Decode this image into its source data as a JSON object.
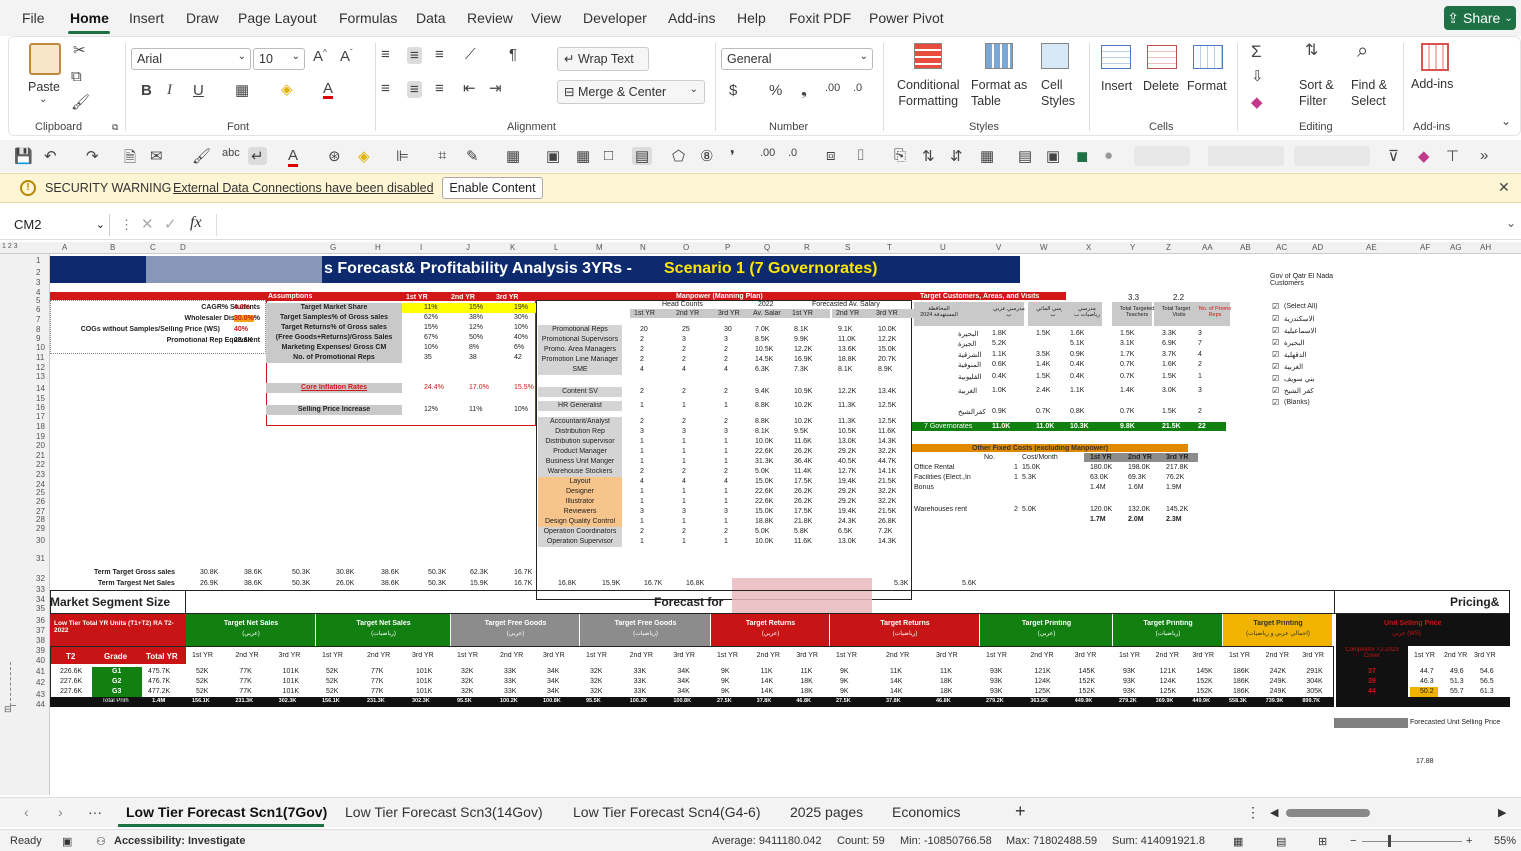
{
  "menu": {
    "items": [
      "File",
      "Home",
      "Insert",
      "Draw",
      "Page Layout",
      "Formulas",
      "Data",
      "Review",
      "View",
      "Developer",
      "Add-ins",
      "Help",
      "Foxit PDF",
      "Power Pivot"
    ],
    "share": "Share"
  },
  "ribbon": {
    "clipboard": {
      "paste": "Paste",
      "label": "Clipboard"
    },
    "font": {
      "name": "Arial",
      "size": "10",
      "label": "Font"
    },
    "alignment": {
      "wrap": "Wrap Text",
      "merge": "Merge & Center",
      "label": "Alignment"
    },
    "number": {
      "format": "General",
      "label": "Number"
    },
    "styles": {
      "conditional": "Conditional\nFormatting",
      "format_table": "Format as\nTable",
      "cell_styles": "Cell\nStyles",
      "label": "Styles"
    },
    "cells": {
      "insert": "Insert",
      "delete": "Delete",
      "format": "Format",
      "label": "Cells"
    },
    "editing": {
      "sort": "Sort &\nFilter",
      "find": "Find &\nSelect",
      "label": "Editing"
    },
    "addins": {
      "addins": "Add-ins",
      "label": "Add-ins"
    }
  },
  "security": {
    "title": "SECURITY WARNING",
    "message": "External Data Connections have been disabled",
    "button": "Enable Content"
  },
  "formula": {
    "name_box": "CM2",
    "fx": "fx",
    "value": ""
  },
  "columns": [
    "A",
    "B",
    "C",
    "D",
    "G",
    "H",
    "I",
    "J",
    "K",
    "L",
    "M",
    "N",
    "O",
    "P",
    "Q",
    "R",
    "S",
    "T",
    "U",
    "V",
    "W",
    "X",
    "Y",
    "Z",
    "AA",
    "AB",
    "AC",
    "AD",
    "AE",
    "AF",
    "AG",
    "AH"
  ],
  "rows": [
    "1",
    "2",
    "3",
    "4",
    "5",
    "6",
    "7",
    "8",
    "9",
    "10",
    "11",
    "12",
    "13",
    "14",
    "15",
    "16",
    "17",
    "18",
    "19",
    "20",
    "21",
    "22",
    "23",
    "24",
    "25",
    "26",
    "27",
    "28",
    "29",
    "30",
    "31",
    "32",
    "33",
    "34",
    "35",
    "36",
    "37",
    "38",
    "39",
    "40",
    "41",
    "42",
    "43",
    "44"
  ],
  "sheet": {
    "title_left": "s Forecast& Profitability Analysis 3YRs - ",
    "title_right": "Scenario 1 (7 Governorates)",
    "assumptions": {
      "header": "Assumptions",
      "rows": [
        {
          "label": "CAGR% Students",
          "val": "4.0%"
        },
        {
          "label": "Wholesaler Discount%",
          "val": "30.0%"
        },
        {
          "label": "COGs without Samples/Selling Price (WS)",
          "val": "40%"
        },
        {
          "label": "Promotional Rep Equivalent",
          "val": "28.6K"
        }
      ],
      "yr_heads": [
        "1st YR",
        "2nd YR",
        "3rd YR"
      ],
      "metrics": [
        {
          "label": "Target Market Share",
          "v": [
            "11%",
            "15%",
            "19%"
          ]
        },
        {
          "label": "Target Samples% of Gross sales",
          "v": [
            "62%",
            "38%",
            "30%"
          ]
        },
        {
          "label": "Target Returns% of Gross sales",
          "v": [
            "15%",
            "12%",
            "10%"
          ]
        },
        {
          "label": "(Free Goods+Returns)/Gross Sales",
          "v": [
            "67%",
            "50%",
            "40%"
          ]
        },
        {
          "label": "Marketing Expenses/ Gross CM",
          "v": [
            "10%",
            "8%",
            "6%"
          ]
        },
        {
          "label": "No. of Promotional Reps",
          "v": [
            "35",
            "38",
            "42"
          ]
        },
        {
          "label": "Core Inflation Rates",
          "v": [
            "24.4%",
            "17.0%",
            "15.5%"
          ]
        },
        {
          "label": "Selling Price Increase",
          "v": [
            "12%",
            "11%",
            "10%"
          ]
        }
      ]
    },
    "manpower": {
      "header": "Manpower (Manning Plan)",
      "sub1": "Head Counts",
      "sub2": "2022",
      "sub3": "Forecasted Av. Salary",
      "cols": [
        "1st YR",
        "2nd YR",
        "3rd YR",
        "Av. Salar",
        "1st YR",
        "2nd YR",
        "3rd YR"
      ],
      "rows": [
        {
          "label": "Promotional Reps",
          "v": [
            "20",
            "25",
            "30",
            "7.0K",
            "8.1K",
            "9.1K",
            "10.0K"
          ]
        },
        {
          "label": "Promotional Supervisors",
          "v": [
            "2",
            "3",
            "3",
            "8.5K",
            "9.9K",
            "11.0K",
            "12.2K"
          ]
        },
        {
          "label": "Promo. Area Managers",
          "v": [
            "2",
            "2",
            "2",
            "10.5K",
            "12.2K",
            "13.6K",
            "15.0K"
          ]
        },
        {
          "label": "Promotion Line Manager",
          "v": [
            "2",
            "2",
            "2",
            "14.5K",
            "16.9K",
            "18.8K",
            "20.7K"
          ]
        },
        {
          "label": "SME",
          "v": [
            "4",
            "4",
            "4",
            "6.3K",
            "7.3K",
            "8.1K",
            "8.9K"
          ]
        },
        {
          "label": "Content SV",
          "v": [
            "2",
            "2",
            "2",
            "9.4K",
            "10.9K",
            "12.2K",
            "13.4K"
          ]
        },
        {
          "label": "HR Generalist",
          "v": [
            "1",
            "1",
            "1",
            "8.8K",
            "10.2K",
            "11.3K",
            "12.5K"
          ]
        },
        {
          "label": "Accountant/Analyst",
          "v": [
            "2",
            "2",
            "2",
            "8.8K",
            "10.2K",
            "11.3K",
            "12.5K"
          ]
        },
        {
          "label": "Distribution Rep",
          "v": [
            "3",
            "3",
            "3",
            "8.1K",
            "9.5K",
            "10.5K",
            "11.6K"
          ]
        },
        {
          "label": "Distribution supervisor",
          "v": [
            "1",
            "1",
            "1",
            "10.0K",
            "11.6K",
            "13.0K",
            "14.3K"
          ]
        },
        {
          "label": "Product Manager",
          "v": [
            "1",
            "1",
            "1",
            "22.6K",
            "26.2K",
            "29.2K",
            "32.2K"
          ]
        },
        {
          "label": "Business Unit Manger",
          "v": [
            "1",
            "1",
            "1",
            "31.3K",
            "36.4K",
            "40.5K",
            "44.7K"
          ]
        },
        {
          "label": "Warehouse Stockers",
          "v": [
            "2",
            "2",
            "2",
            "5.0K",
            "11.4K",
            "12.7K",
            "14.1K"
          ]
        },
        {
          "label": "Layout",
          "v": [
            "4",
            "4",
            "4",
            "15.0K",
            "17.5K",
            "19.4K",
            "21.5K"
          ]
        },
        {
          "label": "Designer",
          "v": [
            "1",
            "1",
            "1",
            "22.6K",
            "26.2K",
            "29.2K",
            "32.2K"
          ]
        },
        {
          "label": "Illustrator",
          "v": [
            "1",
            "1",
            "1",
            "22.6K",
            "26.2K",
            "29.2K",
            "32.2K"
          ]
        },
        {
          "label": "Reviewers",
          "v": [
            "3",
            "3",
            "3",
            "15.0K",
            "17.5K",
            "19.4K",
            "21.5K"
          ]
        },
        {
          "label": "Design Quality Control",
          "v": [
            "1",
            "1",
            "1",
            "18.8K",
            "21.8K",
            "24.3K",
            "26.8K"
          ]
        },
        {
          "label": "Operation Coordinators",
          "v": [
            "2",
            "2",
            "2",
            "5.0K",
            "5.8K",
            "6.5K",
            "7.2K"
          ]
        },
        {
          "label": "Operation Supervisor",
          "v": [
            "1",
            "1",
            "1",
            "10.0K",
            "11.6K",
            "13.0K",
            "14.3K"
          ]
        }
      ]
    },
    "customers": {
      "header": "Target Customers, Areas, and Visits",
      "v33": "3.3",
      "v22": "2.2",
      "cols": [
        "المحافظة المستهدفة 2024",
        "مدرسي عربي ب",
        "مدرسي الماتي ب",
        "مدرسي رياضيات ب",
        "Total Targeted Teachers",
        "Total Targeted Visits",
        "No. of Promo Reps"
      ],
      "rows": [
        {
          "g": "البحيرة",
          "v": [
            "1.8K",
            "1.5K",
            "1.6K",
            "1.5K",
            "3.3K",
            "3"
          ]
        },
        {
          "g": "الجيزة",
          "v": [
            "5.2K",
            "",
            "5.1K",
            "3.1K",
            "6.9K",
            "7"
          ]
        },
        {
          "g": "الشرقية",
          "v": [
            "1.1K",
            "3.5K",
            "0.9K",
            "1.7K",
            "3.7K",
            "4"
          ]
        },
        {
          "g": "المنوفية",
          "v": [
            "0.6K",
            "1.4K",
            "0.4K",
            "0.7K",
            "1.6K",
            "2"
          ]
        },
        {
          "g": "القليوبية",
          "v": [
            "0.4K",
            "1.5K",
            "0.4K",
            "0.7K",
            "1.5K",
            "1"
          ]
        },
        {
          "g": "الغربية",
          "v": [
            "1.0K",
            "2.4K",
            "1.1K",
            "1.4K",
            "3.0K",
            "3"
          ]
        },
        {
          "g": "كفرالشيخ",
          "v": [
            "0.9K",
            "0.7K",
            "0.8K",
            "0.7K",
            "1.5K",
            "2"
          ]
        }
      ],
      "total": {
        "label": "7 Governorates",
        "v": [
          "11.0K",
          "11.0K",
          "10.3K",
          "9.8K",
          "21.5K",
          "22"
        ]
      }
    },
    "filter": {
      "title": "Gov of Qatr El Nada Customers",
      "items": [
        "(Select All)",
        "الاسكندرية",
        "الاسماعيلية",
        "البحيرة",
        "الدقهلية",
        "الغربية",
        "بني سويف",
        "كفر الشيخ",
        "(Blanks)"
      ]
    },
    "fixed_costs": {
      "header": "Other Fixed Costs (excluding Manpower)",
      "cols": [
        "No.",
        "Cost/Month",
        "1st YR",
        "2nd YR",
        "3rd YR"
      ],
      "rows": [
        {
          "label": "Office Rental",
          "v": [
            "1",
            "15.0K",
            "180.0K",
            "198.0K",
            "217.8K"
          ]
        },
        {
          "label": "Facilities (Elect.,In",
          "v": [
            "1",
            "5.3K",
            "63.0K",
            "69.3K",
            "76.2K"
          ]
        },
        {
          "label": "Bonus",
          "v": [
            "",
            "",
            "1.4M",
            "1.6M",
            "1.9M"
          ]
        },
        {
          "label": "Warehouses rent",
          "v": [
            "2",
            "5.0K",
            "120.0K",
            "132.0K",
            "145.2K"
          ]
        },
        {
          "label": "",
          "v": [
            "",
            "",
            "1.7M",
            "2.0M",
            "2.3M"
          ]
        }
      ]
    },
    "targets": {
      "gross_label": "Term Target Gross sales",
      "net_label": "Term Targest Net Sales",
      "gross": [
        "30.8K",
        "38.6K",
        "50.3K",
        "30.8K",
        "38.6K",
        "50.3K",
        "62.3K",
        "16.7K"
      ],
      "net": [
        "26.9K",
        "38.6K",
        "50.3K",
        "26.0K",
        "38.6K",
        "50.3K",
        "15.9K",
        "16.7K",
        "16.8K",
        "15.9K",
        "16.7K",
        "16.8K",
        "5.3K",
        "5.6K"
      ]
    },
    "market": {
      "left": "Market Segment Size",
      "center": "Forecast for",
      "right": "Pricing&"
    },
    "lower": {
      "low_tier": "Low Tier Total YR Units (T1+T2) RA T2-2022",
      "t2": "T2",
      "grade": "Grade",
      "total_yr": "Total YR",
      "groups": [
        {
          "name": "Target Net Sales",
          "sub": "(عربي)",
          "color": "#118011"
        },
        {
          "name": "Target Net Sales",
          "sub": "(رياضيات)",
          "color": "#118011"
        },
        {
          "name": "Target Free Goods",
          "sub": "(عربي)",
          "color": "#8c8c8c"
        },
        {
          "name": "Target Free Goods",
          "sub": "(رياضيات)",
          "color": "#8c8c8c"
        },
        {
          "name": "Target Returns",
          "sub": "(عربي)",
          "color": "#c81414"
        },
        {
          "name": "Target Returns",
          "sub": "(رياضيات)",
          "color": "#c81414"
        },
        {
          "name": "Target Printing",
          "sub": "(عربي)",
          "color": "#118011"
        },
        {
          "name": "Target Printing",
          "sub": "(رياضيات)",
          "color": "#118011"
        },
        {
          "name": "Target Printing",
          "sub": "(اجمالي عربي و رياضيات)",
          "color": "#f0b400"
        }
      ],
      "yrs": [
        "1st YR",
        "2nd YR",
        "3rd YR"
      ],
      "rows": [
        {
          "t2": "226.6K",
          "g": "G1",
          "tot": "475.7K",
          "v": [
            "52K",
            "77K",
            "101K",
            "52K",
            "77K",
            "101K",
            "32K",
            "33K",
            "34K",
            "32K",
            "33K",
            "34K",
            "9K",
            "11K",
            "11K",
            "9K",
            "11K",
            "11K",
            "93K",
            "121K",
            "145K",
            "93K",
            "121K",
            "145K",
            "186K",
            "242K",
            "291K"
          ]
        },
        {
          "t2": "227.6K",
          "g": "G2",
          "tot": "476.7K",
          "v": [
            "52K",
            "77K",
            "101K",
            "52K",
            "77K",
            "101K",
            "32K",
            "33K",
            "34K",
            "32K",
            "33K",
            "34K",
            "9K",
            "14K",
            "18K",
            "9K",
            "14K",
            "18K",
            "93K",
            "124K",
            "152K",
            "93K",
            "124K",
            "152K",
            "186K",
            "249K",
            "304K"
          ]
        },
        {
          "t2": "227.6K",
          "g": "G3",
          "tot": "477.2K",
          "v": [
            "52K",
            "77K",
            "101K",
            "52K",
            "77K",
            "101K",
            "32K",
            "33K",
            "34K",
            "32K",
            "33K",
            "34K",
            "9K",
            "14K",
            "18K",
            "9K",
            "14K",
            "18K",
            "93K",
            "125K",
            "152K",
            "93K",
            "125K",
            "152K",
            "186K",
            "249K",
            "305K"
          ]
        }
      ],
      "total": {
        "label": "Total Prim",
        "tot": "1.4M",
        "v": [
          "156.1K",
          "231.3K",
          "302.3K",
          "156.1K",
          "231.3K",
          "302.3K",
          "95.5K",
          "100.2K",
          "100.8K",
          "95.5K",
          "100.2K",
          "100.8K",
          "27.5K",
          "37.8K",
          "46.8K",
          "27.5K",
          "37.8K",
          "46.8K",
          "279.2K",
          "363.5K",
          "449.9K",
          "279.2K",
          "369.9K",
          "449.9K",
          "558.3K",
          "739.9K",
          "899.7K"
        ]
      }
    },
    "pricing": {
      "header": "Unit Selling Price",
      "sub": "عربي (WS)",
      "competitor": "Competitor T2-2023 Cover",
      "yrs": [
        "1st YR",
        "2nd YR",
        "3rd YR"
      ],
      "rows": [
        {
          "c": "37",
          "v": [
            "44.7",
            "49.6",
            "54.6"
          ]
        },
        {
          "c": "39",
          "v": [
            "46.3",
            "51.3",
            "56.5"
          ]
        },
        {
          "c": "44",
          "v": [
            "50.2",
            "55.7",
            "61.3"
          ]
        }
      ],
      "legend": "Forecasted Unit Selling Price",
      "value": "17.88"
    }
  },
  "tabs": {
    "items": [
      "Low Tier Forecast Scn1(7Gov)",
      "Low Tier Forecast Scn3(14Gov)",
      "Low Tier Forecast Scn4(G4-6)",
      "2025 pages",
      "Economics"
    ],
    "active": 0
  },
  "status": {
    "ready": "Ready",
    "accessibility": "Accessibility: Investigate",
    "average": "Average: 9411180.042",
    "count": "Count: 59",
    "min": "Min: -10850766.58",
    "max": "Max: 71802488.59",
    "sum": "Sum: 414091921.8",
    "zoom": "55%"
  }
}
